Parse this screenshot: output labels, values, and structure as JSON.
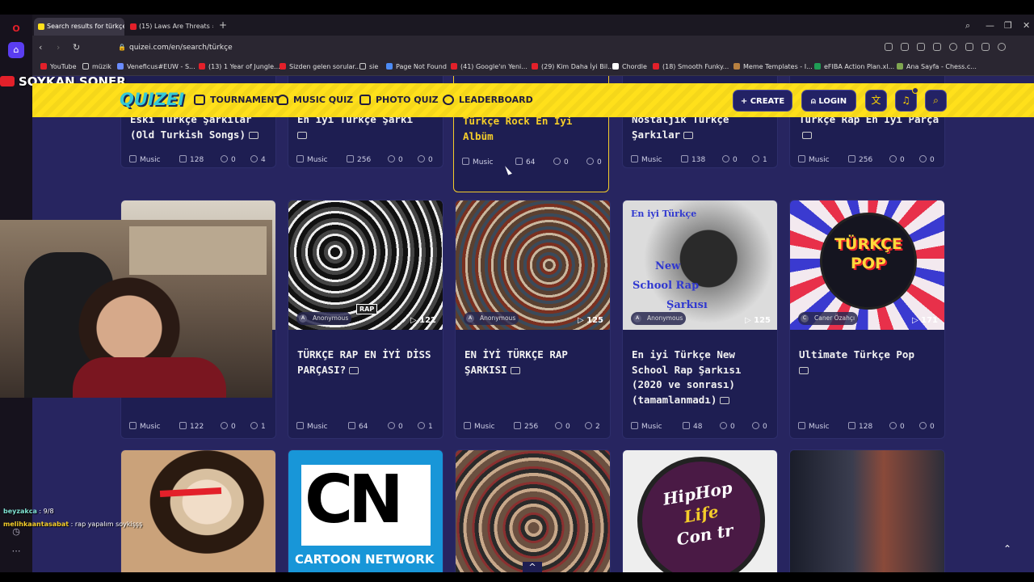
{
  "browser": {
    "tabs": [
      {
        "title": "Search results for türkçe",
        "active": true
      },
      {
        "title": "(15) Laws Are Threats #sh",
        "active": false
      }
    ],
    "url": "quizei.com/en/search/türkçe",
    "bookmarks": [
      "YouTube",
      "müzik",
      "Veneficus#EUW - S...",
      "(13) 1 Year of Jungle...",
      "Sizden gelen sorular...",
      "sie",
      "Page Not Found",
      "(41) Google'ın Yeni...",
      "(29) Kim Daha İyi Bil...",
      "Chordle",
      "(18) Smooth Funky...",
      "Meme Templates - I...",
      "eFIBA Action Plan.xl...",
      "Ana Sayfa - Chess.c..."
    ]
  },
  "overlay": {
    "streamer": "SOYKAN SONER",
    "chat": [
      {
        "user": "beyzakca",
        "msg": " : 9/8"
      },
      {
        "user": "melihkaantasabat",
        "msg": " : rap yapalım soykişşş"
      }
    ]
  },
  "site": {
    "logo": "QUIZEI",
    "nav": [
      "TOURNAMENT",
      "MUSIC QUIZ",
      "PHOTO QUIZ",
      "LEADERBOARD"
    ],
    "create_label": "CREATE",
    "login_label": "LOGIN",
    "notification_count": "1"
  },
  "row1": [
    {
      "title": "Eski Türkçe Şarkılar (Old Turkish Songs)",
      "category": "Music",
      "questions": "128",
      "comments": "0",
      "likes": "4"
    },
    {
      "title": "En iyi Türkçe Şarkı",
      "category": "Music",
      "questions": "256",
      "comments": "0",
      "likes": "0"
    },
    {
      "title": "Türkçe Rock En İyi Albüm",
      "category": "Music",
      "questions": "64",
      "comments": "0",
      "likes": "0"
    },
    {
      "title": "Nostaljik Türkçe Şarkılar",
      "category": "Music",
      "questions": "138",
      "comments": "0",
      "likes": "1"
    },
    {
      "title": "Türkçe Rap En İyi Parça",
      "category": "Music",
      "questions": "256",
      "comments": "0",
      "likes": "0"
    }
  ],
  "row2": [
    {
      "title": "",
      "author": "",
      "plays": "",
      "category": "Music",
      "questions": "122",
      "comments": "0",
      "likes": "1"
    },
    {
      "title": "TÜRKÇE RAP EN İYİ DİSS PARÇASI?",
      "author": "Anonymous",
      "author_initial": "A",
      "plays": "122",
      "category": "Music",
      "questions": "64",
      "comments": "0",
      "likes": "1"
    },
    {
      "title": "EN İYİ TÜRKÇE RAP ŞARKISI",
      "author": "Anonymous",
      "author_initial": "A",
      "plays": "125",
      "category": "Music",
      "questions": "256",
      "comments": "0",
      "likes": "2"
    },
    {
      "title": "En iyi Türkçe New School Rap Şarkısı (2020 ve sonrası) (tamamlanmadı)",
      "author": "Anonymous",
      "author_initial": "A",
      "plays": "125",
      "category": "Music",
      "questions": "48",
      "comments": "0",
      "likes": "0"
    },
    {
      "title": "Ultimate Türkçe Pop",
      "author": "Caner Özahçı",
      "author_initial": "C",
      "plays": "171",
      "category": "Music",
      "questions": "128",
      "comments": "0",
      "likes": "0"
    }
  ],
  "thumb_texts": {
    "rap_badge": "RAP",
    "cat_lines": [
      "En iyi Türkçe",
      "New",
      "School Rap",
      "Şarkısı"
    ],
    "pop_lines": [
      "TÜRKÇE",
      "POP"
    ],
    "cn_letters": "CN",
    "cn_network": "CARTOON NETWORK",
    "hiphop_lines": [
      "HipHop",
      "Life",
      "Con tr"
    ]
  },
  "colors": {
    "accent": "#ffe01b",
    "page_bg": "#272560",
    "card_bg": "#1e1e52",
    "highlight": "#f5cd2a"
  }
}
